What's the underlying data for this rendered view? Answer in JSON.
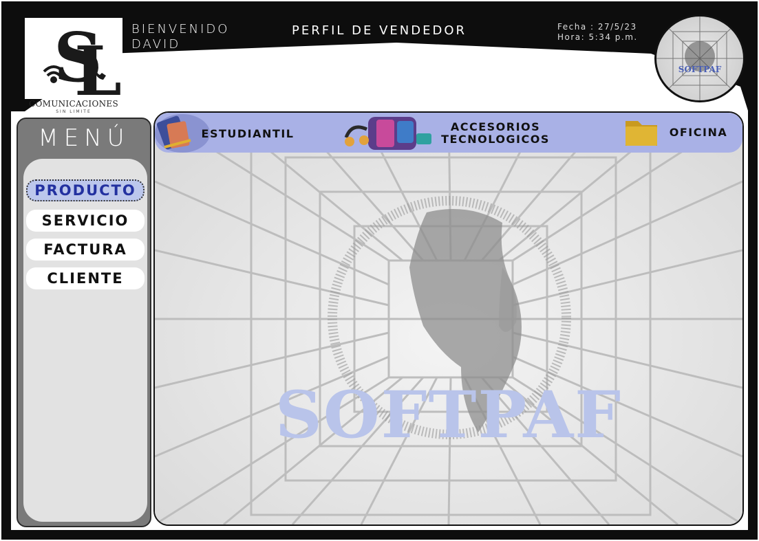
{
  "header": {
    "welcome_line1": "BIENVENIDO",
    "welcome_line2": "DAVID",
    "profile_title": "PERFIL DE VENDEDOR",
    "date_label": "Fecha : 27/5/23",
    "time_label": "Hora: 5:34 p.m.",
    "logo_brand": "COMUNICACIONES",
    "logo_tagline": "SIN LIMITE",
    "logo_initials": "SL",
    "badge_text": "SOFTPAF"
  },
  "sidebar": {
    "title": "MENÚ",
    "items": [
      {
        "label": "PRODUCTO",
        "active": true
      },
      {
        "label": "SERVICIO",
        "active": false
      },
      {
        "label": "FACTURA",
        "active": false
      },
      {
        "label": "CLIENTE",
        "active": false
      }
    ]
  },
  "categories": [
    {
      "label": "ESTUDIANTIL",
      "icon": "notebook-icon"
    },
    {
      "label_line1": "ACCESORIOS",
      "label_line2": "TECNOLOGICOS",
      "icon": "gadgets-icon"
    },
    {
      "label": "OFICINA",
      "icon": "folder-icon"
    }
  ],
  "watermark": "SOFTPAF",
  "colors": {
    "frame": "#0d0d0d",
    "sidebar": "#7a7a7a",
    "category_bar": "#a9b1e6",
    "active_item": "#bcc7ec",
    "active_text": "#2331a0",
    "watermark": "#b9c4ea"
  }
}
